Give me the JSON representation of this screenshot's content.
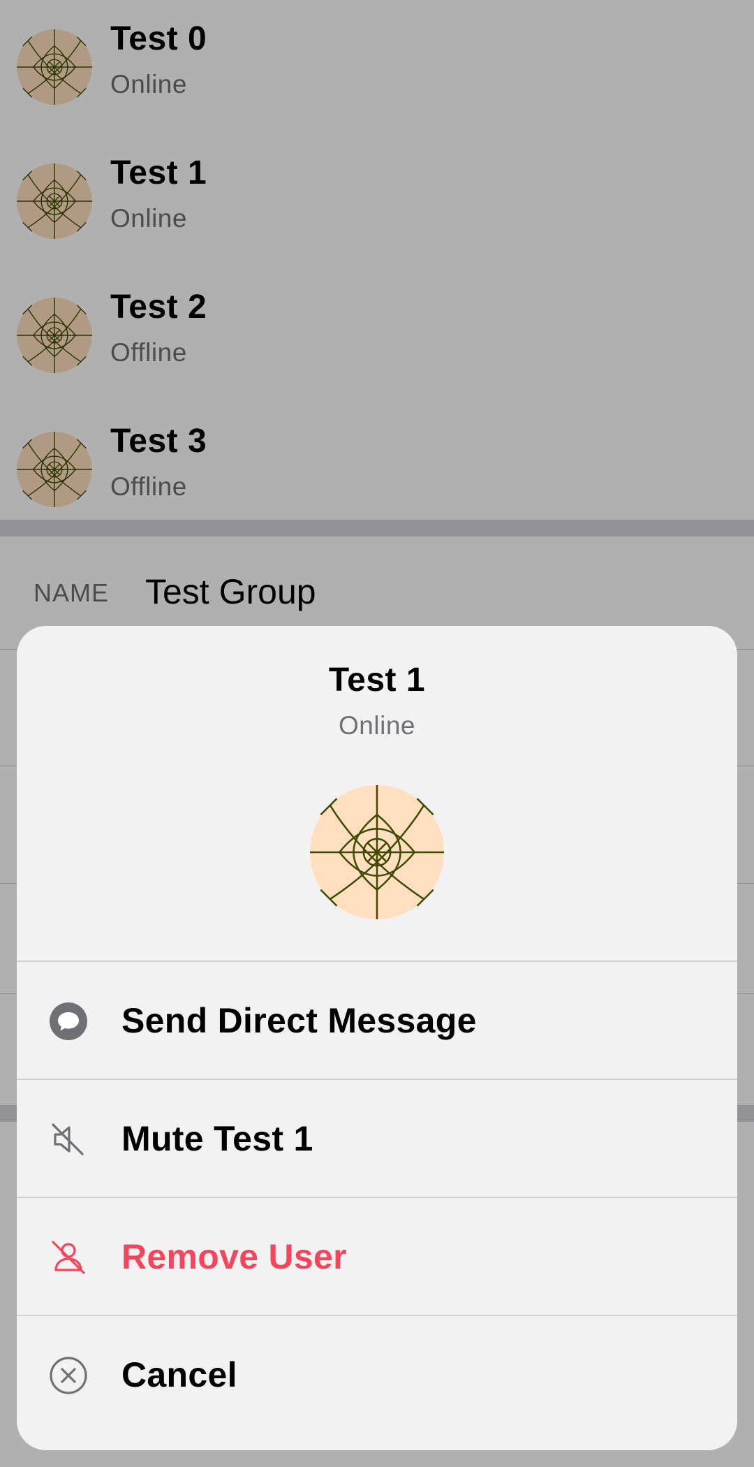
{
  "members": [
    {
      "name": "Test 0",
      "status": "Online"
    },
    {
      "name": "Test 1",
      "status": "Online"
    },
    {
      "name": "Test 2",
      "status": "Offline"
    },
    {
      "name": "Test 3",
      "status": "Offline"
    }
  ],
  "group": {
    "name_label": "NAME",
    "name_value": "Test Group"
  },
  "sheet": {
    "title": "Test 1",
    "subtitle": "Online",
    "actions": [
      {
        "label": "Send Direct Message",
        "icon": "chat-bubble-icon"
      },
      {
        "label": "Mute Test 1",
        "icon": "mute-icon"
      },
      {
        "label": "Remove User",
        "icon": "remove-user-icon"
      },
      {
        "label": "Cancel",
        "icon": "cancel-icon"
      }
    ]
  },
  "colors": {
    "danger": "#f5455c",
    "sheet_background": "#f2f2f2",
    "avatar_fill": "#ffdfc0",
    "avatar_lines": "#3d4a00",
    "secondary_text": "#6f6f75",
    "icon_gray": "#6f6f75"
  }
}
